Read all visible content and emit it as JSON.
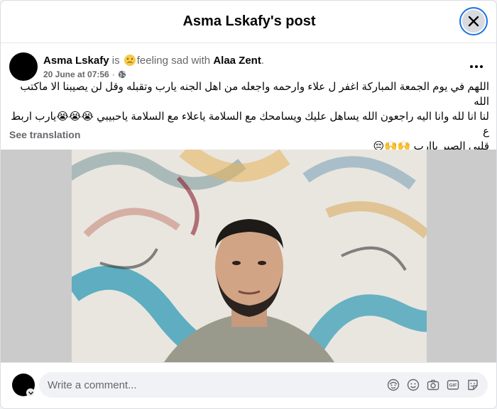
{
  "header": {
    "title": "Asma Lskafy's post"
  },
  "post": {
    "author": "Asma Lskafy",
    "is_text": "is",
    "feeling_text": "feeling sad with",
    "with_name": "Alaa Zent",
    "period": ".",
    "timestamp": "20 June at 07:56",
    "sep": "·",
    "text_line1": "اللهم في يوم الجمعة المباركة اغفر ل علاء وارحمه واجعله من اهل الجنه يارب وتقبله وقل لن يصيبنا الا ماكتب الله",
    "text_line2": "لنا انا لله وانا اليه راجعون الله يساهل عليك ويسامحك مع السلامة ياعلاء مع السلامة ياحبيبي 😭😭😭يارب اربط ع",
    "text_line3": "قلبي الصبر ياارب 🙌🙌😔",
    "see_translation": "See translation"
  },
  "comment": {
    "placeholder": "Write a comment..."
  },
  "icons": {
    "close": "close-icon",
    "more": "more-options-icon",
    "globe": "globe-icon",
    "avatar_sticker": "avatar-sticker-icon",
    "emoji": "emoji-icon",
    "camera": "camera-icon",
    "gif": "gif-icon",
    "sticker": "sticker-icon"
  },
  "colors": {
    "accent": "#1b74e4",
    "secondary_text": "#65676b"
  }
}
